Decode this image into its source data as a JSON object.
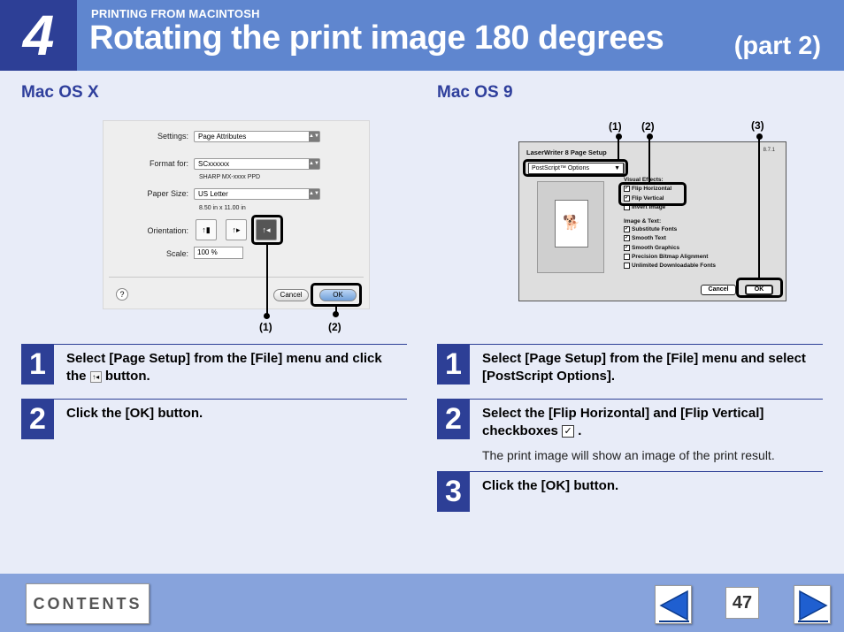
{
  "header": {
    "chapter_number": "4",
    "section_label": "PRINTING FROM MACINTOSH",
    "title": "Rotating the print image 180 degrees",
    "part": "(part 2)"
  },
  "colors": {
    "header_bg": "#5f86cf",
    "chapter_bg": "#2d3f96",
    "heading_text": "#2f3f9c",
    "page_bg": "#e8ecf8",
    "footer_bg": "#87a3dc",
    "nav_arrow": "#1f5fd0"
  },
  "left_column": {
    "heading": "Mac OS X",
    "dialog": {
      "settings_label": "Settings:",
      "settings_value": "Page Attributes",
      "format_label": "Format for:",
      "format_value": "SCxxxxxx",
      "format_sub": "SHARP MX-xxxx PPD",
      "paper_label": "Paper Size:",
      "paper_value": "US Letter",
      "paper_sub": "8.50 in x 11.00 in",
      "orientation_label": "Orientation:",
      "scale_label": "Scale:",
      "scale_value": "100 %",
      "help_label": "?",
      "cancel_label": "Cancel",
      "ok_label": "OK"
    },
    "callouts": [
      "(1)",
      "(2)"
    ],
    "steps": [
      {
        "number": "1",
        "text_before": "Select [Page Setup] from the [File] menu and click the",
        "text_after": "button."
      },
      {
        "number": "2",
        "text": "Click the [OK] button."
      }
    ]
  },
  "right_column": {
    "heading": "Mac OS 9",
    "dialog": {
      "title": "LaserWriter 8 Page Setup",
      "version": "8.7.1",
      "popup_value": "PostScript™ Options",
      "visual_effects_label": "Visual Effects:",
      "visual_checks": [
        {
          "label": "Flip Horizontal",
          "checked": true
        },
        {
          "label": "Flip Vertical",
          "checked": true
        },
        {
          "label": "Invert Image",
          "checked": false
        }
      ],
      "image_text_label": "Image & Text:",
      "image_checks": [
        {
          "label": "Substitute Fonts",
          "checked": true
        },
        {
          "label": "Smooth Text",
          "checked": true
        },
        {
          "label": "Smooth Graphics",
          "checked": true
        },
        {
          "label": "Precision Bitmap Alignment",
          "checked": false
        },
        {
          "label": "Unlimited Downloadable Fonts",
          "checked": false
        }
      ],
      "cancel_label": "Cancel",
      "ok_label": "OK"
    },
    "callouts": [
      "(1)",
      "(2)",
      "(3)"
    ],
    "steps": [
      {
        "number": "1",
        "text": "Select [Page Setup] from the [File] menu and select [PostScript Options]."
      },
      {
        "number": "2",
        "text_before": "Select the [Flip Horizontal] and [Flip Vertical] checkboxes",
        "text_after": ".",
        "note": "The print image will show an image of the print result."
      },
      {
        "number": "3",
        "text": "Click the [OK] button."
      }
    ]
  },
  "footer": {
    "contents_label": "CONTENTS",
    "page_number": "47",
    "prev_icon": "left-arrow-icon",
    "next_icon": "right-arrow-icon"
  }
}
